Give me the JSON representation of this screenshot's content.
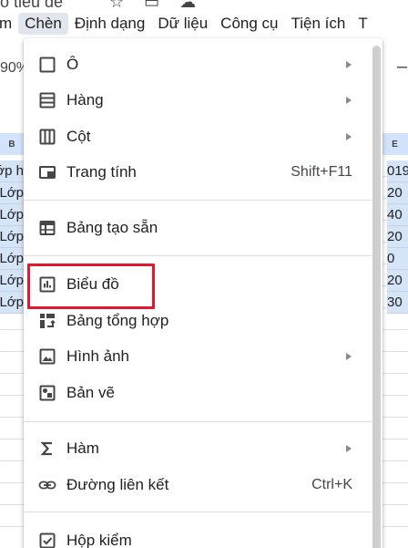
{
  "doc": {
    "title_fragment": "ô tiêu đề"
  },
  "menubar": {
    "items": [
      {
        "label": "m"
      },
      {
        "label": "Chèn"
      },
      {
        "label": "Định dạng"
      },
      {
        "label": "Dữ liệu"
      },
      {
        "label": "Công cụ"
      },
      {
        "label": "Tiện ích"
      },
      {
        "label": "T"
      }
    ],
    "active": "Chèn"
  },
  "toolbar": {
    "zoom_fragment": "90%",
    "minus_fragment": "–"
  },
  "sheet": {
    "left_col_header": "B",
    "right_col_header": "E",
    "left_cells": [
      "ớp h",
      "Lớp",
      "Lớp",
      "Lớp",
      "Lớp",
      "Lớp",
      "Lớp"
    ],
    "right_cells": [
      "019",
      "20",
      "40",
      "20",
      "0",
      "20",
      "30"
    ]
  },
  "menu": {
    "items": [
      {
        "id": "cell",
        "label": "Ô",
        "icon": "square-icon",
        "submenu": true,
        "shortcut": ""
      },
      {
        "id": "row",
        "label": "Hàng",
        "icon": "rows-icon",
        "submenu": true,
        "shortcut": ""
      },
      {
        "id": "column",
        "label": "Cột",
        "icon": "columns-icon",
        "submenu": true,
        "shortcut": ""
      },
      {
        "id": "sheet",
        "label": "Trang tính",
        "icon": "sheet-tab-icon",
        "submenu": false,
        "shortcut": "Shift+F11"
      },
      {
        "id": "preset-table",
        "label": "Bảng tạo sẵn",
        "icon": "table-icon",
        "submenu": false,
        "shortcut": ""
      },
      {
        "id": "chart",
        "label": "Biểu đồ",
        "icon": "chart-icon",
        "submenu": false,
        "shortcut": ""
      },
      {
        "id": "pivot",
        "label": "Bảng tổng hợp",
        "icon": "pivot-table-icon",
        "submenu": false,
        "shortcut": ""
      },
      {
        "id": "image",
        "label": "Hình ảnh",
        "icon": "image-icon",
        "submenu": true,
        "shortcut": ""
      },
      {
        "id": "drawing",
        "label": "Bản vẽ",
        "icon": "drawing-icon",
        "submenu": false,
        "shortcut": ""
      },
      {
        "id": "function",
        "label": "Hàm",
        "icon": "sigma-icon",
        "submenu": true,
        "shortcut": ""
      },
      {
        "id": "link",
        "label": "Đường liên kết",
        "icon": "link-icon",
        "submenu": false,
        "shortcut": "Ctrl+K"
      },
      {
        "id": "checkbox",
        "label": "Hộp kiểm",
        "icon": "checkbox-icon",
        "submenu": false,
        "shortcut": ""
      }
    ],
    "highlighted": "Biểu đồ"
  },
  "colors": {
    "highlight_border": "#e0192e",
    "menu_active_bg": "#e1e6ee",
    "header_bg": "#d3e3fd"
  }
}
